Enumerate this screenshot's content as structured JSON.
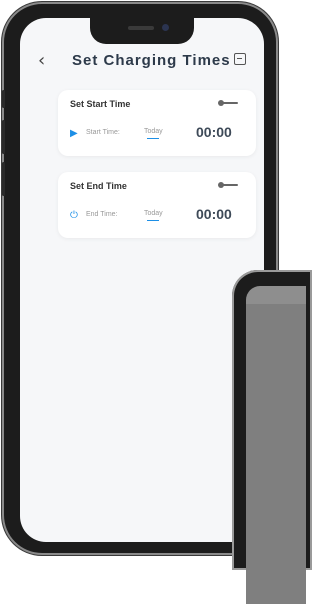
{
  "header": {
    "back_icon": "‹",
    "title": "Set Charging Times",
    "save_icon": "save-icon"
  },
  "cards": [
    {
      "title": "Set Start Time",
      "icon": "play-icon",
      "icon_glyph": "▶",
      "label": "Start Time:",
      "day": "Today",
      "time": "00:00",
      "enabled": false
    },
    {
      "title": "Set End Time",
      "icon": "power-icon",
      "icon_glyph": "⏻",
      "label": "End Time:",
      "day": "Today",
      "time": "00:00",
      "enabled": false
    }
  ],
  "colors": {
    "accent": "#1d8fe6",
    "background": "#f6f7f9",
    "title": "#2d3a4a"
  }
}
